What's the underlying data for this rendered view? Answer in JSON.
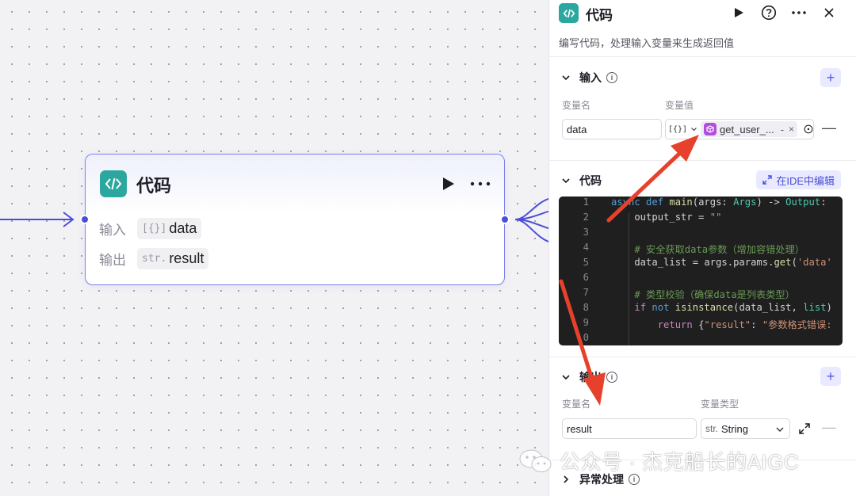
{
  "node": {
    "title": "代码",
    "input_label": "输入",
    "input_tag": "[{}]",
    "input_value": "data",
    "output_label": "输出",
    "output_tag": "str.",
    "output_value": "result"
  },
  "panel": {
    "title": "代码",
    "description": "编写代码，处理输入变量来生成返回值",
    "inputs": {
      "heading": "输入",
      "col_name": "变量名",
      "col_value": "变量值",
      "name_value": "data",
      "type_tag": "[{}]",
      "ref_value": "get_user_...",
      "ref_suffix": "-",
      "ref_close": "×"
    },
    "code": {
      "heading": "代码",
      "ide_button": "在IDE中编辑",
      "line_numbers": [
        "1",
        "2",
        "3",
        "4",
        "5",
        "6",
        "7",
        "8",
        "9",
        "0"
      ]
    },
    "outputs": {
      "heading": "输出",
      "col_name": "变量名",
      "col_type": "变量类型",
      "name_value": "result",
      "type_tag": "str.",
      "type_value": "String"
    },
    "error": {
      "heading": "异常处理"
    }
  },
  "watermark": "公众号 · 杰克船长的AIGC",
  "colors": {
    "accent": "#4b4fd6",
    "node_border": "#7b7fe8",
    "code_logo": "#2ba7a0",
    "arrow": "#e8412b",
    "editor_bg": "#1f1f1f"
  }
}
